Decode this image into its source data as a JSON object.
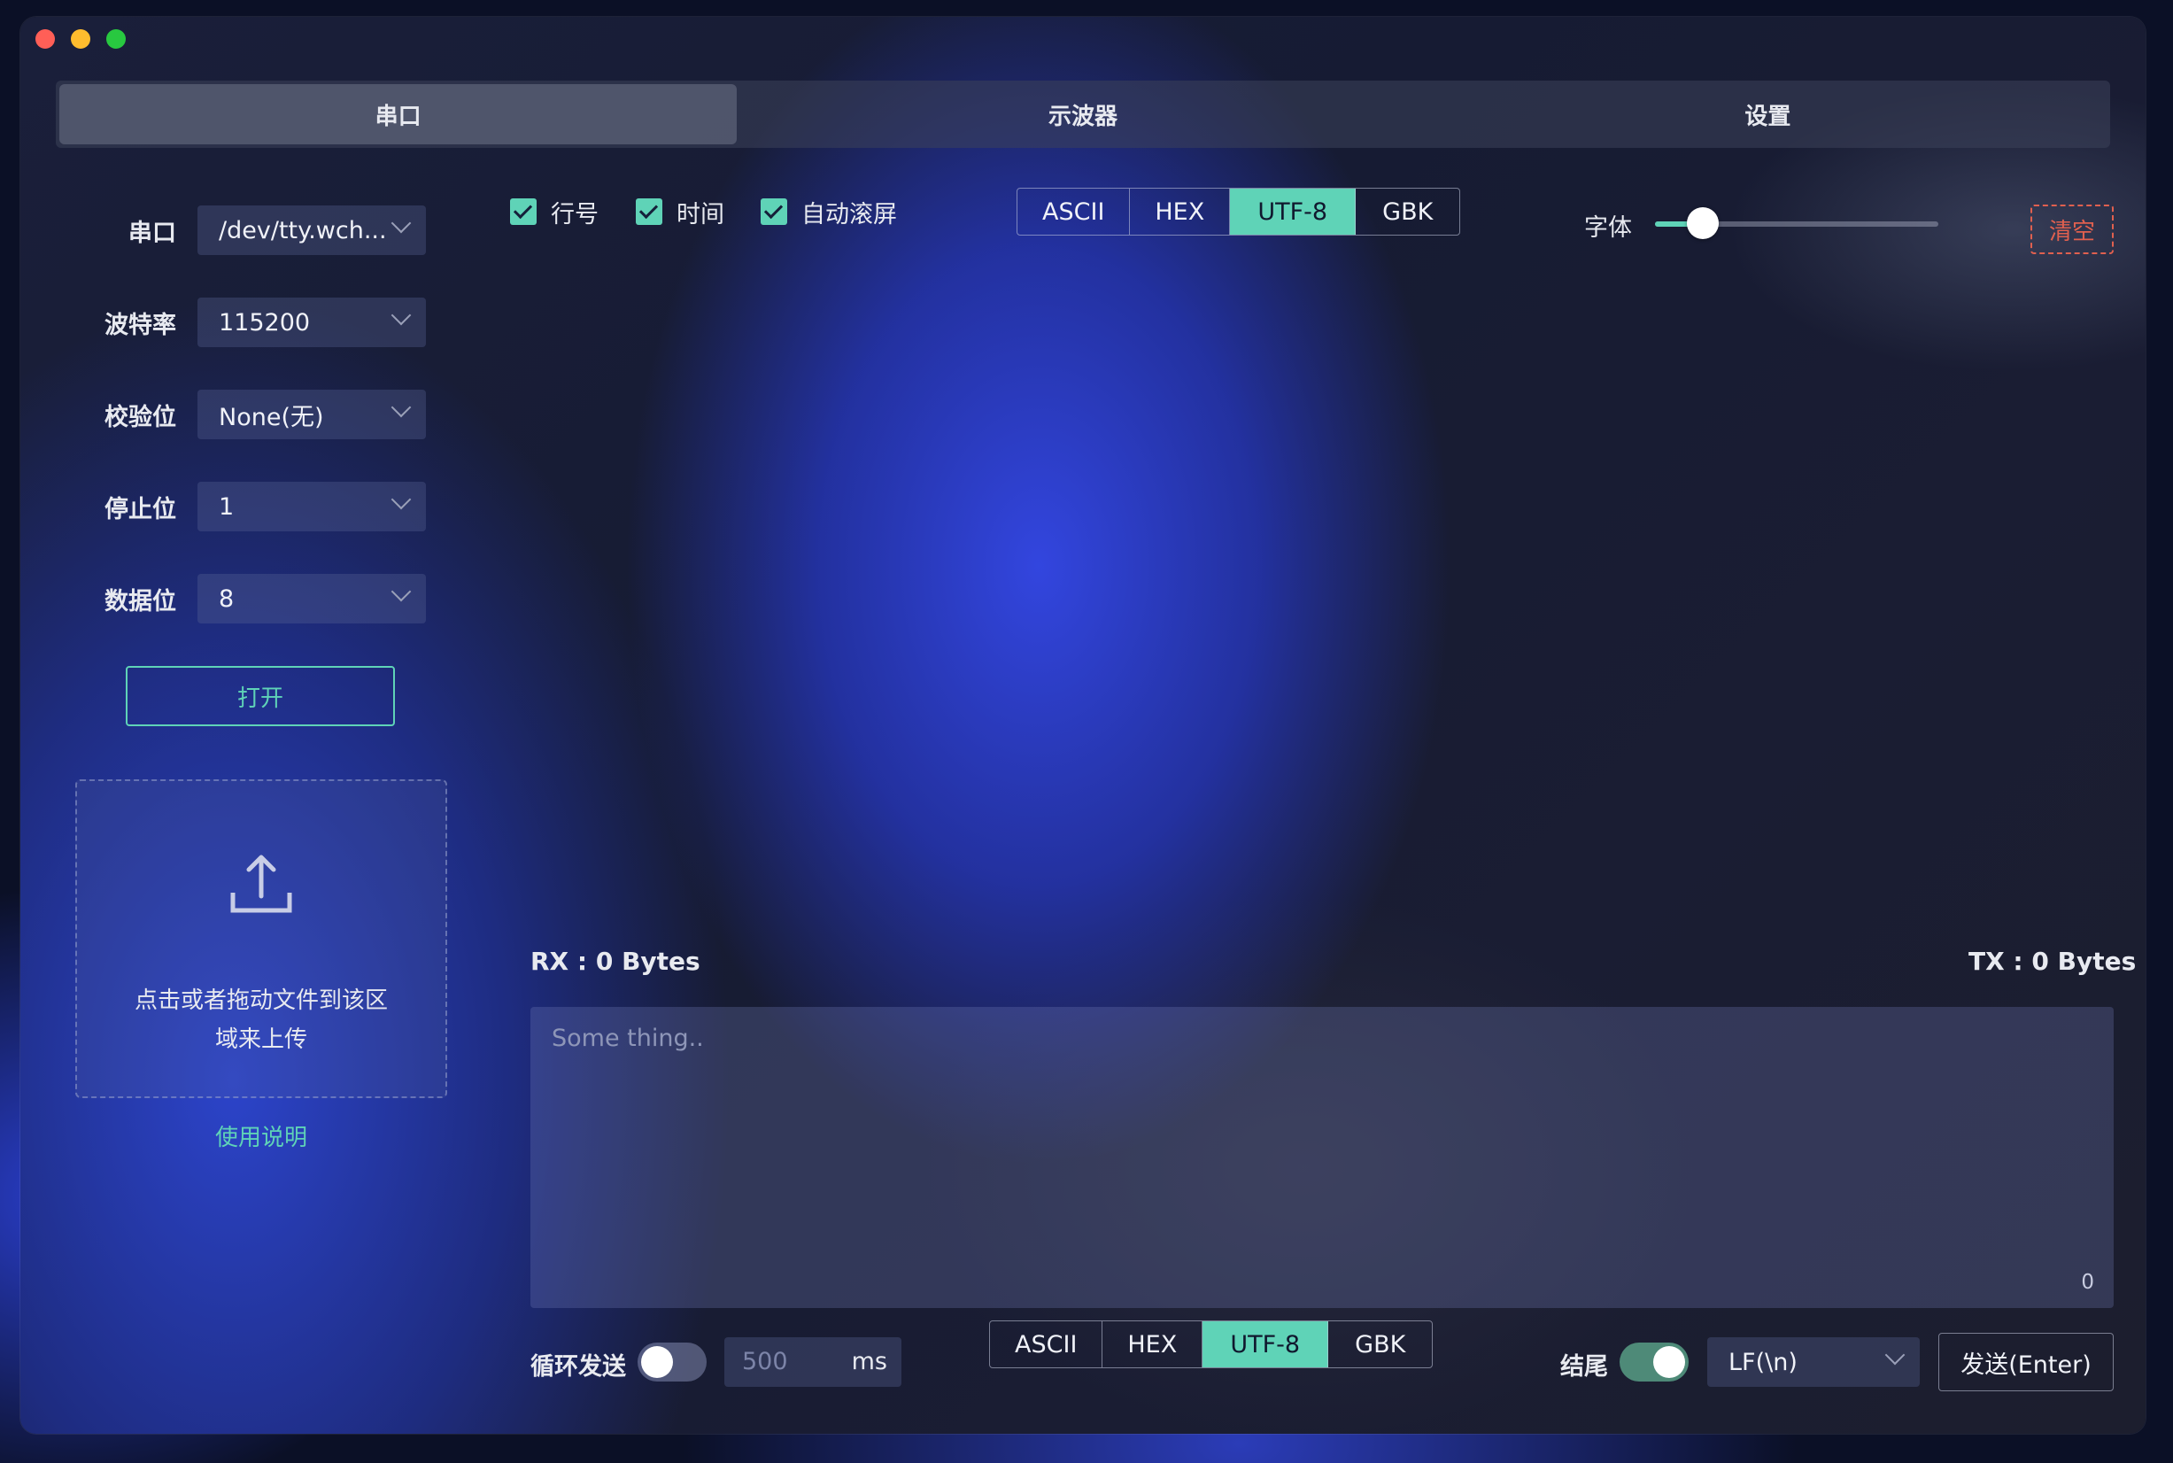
{
  "tabs": [
    {
      "label": "串口",
      "active": true
    },
    {
      "label": "示波器",
      "active": false
    },
    {
      "label": "设置",
      "active": false
    }
  ],
  "serial": {
    "port": {
      "label": "串口",
      "value": "/dev/tty.wch..."
    },
    "baud": {
      "label": "波特率",
      "value": "115200"
    },
    "parity": {
      "label": "校验位",
      "value": "None(无)"
    },
    "stopbits": {
      "label": "停止位",
      "value": "1"
    },
    "databits": {
      "label": "数据位",
      "value": "8"
    },
    "open_label": "打开"
  },
  "upload": {
    "line1": "点击或者拖动文件到该区",
    "line2": "域来上传"
  },
  "help_label": "使用说明",
  "toolbar": {
    "line_no": "行号",
    "time": "时间",
    "autoscroll": "自动滚屏",
    "encodings": [
      "ASCII",
      "HEX",
      "UTF-8",
      "GBK"
    ],
    "active_encoding": "UTF-8",
    "font_label": "字体",
    "font_level": 0.17,
    "clear_label": "清空"
  },
  "counters": {
    "rx": "RX : 0 Bytes",
    "tx": "TX : 0 Bytes"
  },
  "send": {
    "placeholder": "Some thing..",
    "char_count": "0",
    "loop_label": "循环发送",
    "interval_placeholder": "500",
    "interval_unit": "ms",
    "encodings": [
      "ASCII",
      "HEX",
      "UTF-8",
      "GBK"
    ],
    "active_encoding": "UTF-8",
    "ending_label": "结尾",
    "ending_value": "LF(\\n)",
    "send_label": "发送(Enter)"
  },
  "colors": {
    "accent": "#5fd3b7",
    "danger": "#e0604f"
  }
}
